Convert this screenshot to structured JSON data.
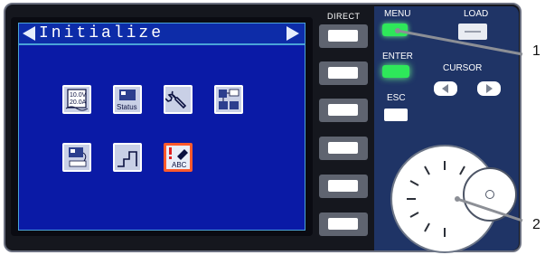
{
  "screen": {
    "title": "Initialize",
    "icons": [
      {
        "name": "voltage-current-settings",
        "label": "10.0V 20.0A"
      },
      {
        "name": "status",
        "label": "Status"
      },
      {
        "name": "wrench-tools",
        "label": ""
      },
      {
        "name": "network-devices",
        "label": ""
      },
      {
        "name": "keyboard-device",
        "label": ""
      },
      {
        "name": "step-sequence",
        "label": ""
      },
      {
        "name": "abc-eraser-initialize",
        "label": "ABC"
      }
    ]
  },
  "direct": {
    "label": "DIRECT",
    "buttons": 6
  },
  "panel": {
    "menu_label": "MENU",
    "load_label": "LOAD",
    "enter_label": "ENTER",
    "cursor_label": "CURSOR",
    "esc_label": "ESC"
  },
  "callouts": [
    "1",
    "2"
  ],
  "colors": {
    "screen": "#0a1aa6",
    "panel": "#1f3466",
    "menu_led": "#2ee85a",
    "selected_border": "#ff5a2c"
  }
}
